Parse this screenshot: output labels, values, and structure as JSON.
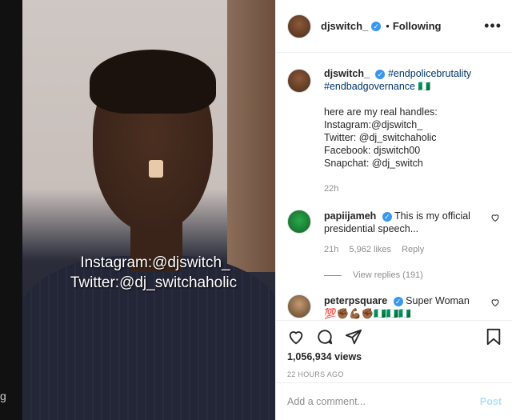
{
  "left_gutter": {
    "glyph": "g"
  },
  "video": {
    "overlay_line1": "Instagram:@djswitch_",
    "overlay_line2": "Twitter:@dj_switchaholic"
  },
  "header": {
    "username": "djswitch_",
    "separator": "•",
    "follow_status": "Following",
    "more": "•••"
  },
  "caption": {
    "username": "djswitch_",
    "hashtag1": "#endpolicebrutality",
    "hashtag2": "#endbadgovernance",
    "flag": "🇳🇬",
    "lines": [
      "here are my real handles:",
      "Instagram:@djswitch_",
      "Twitter: @dj_switchaholic",
      "Facebook: djswitch00",
      "Snapchat: @dj_switch"
    ],
    "time": "22h"
  },
  "comments": [
    {
      "username": "papiijameh",
      "text_line1": "This is my official",
      "text_line2": "presidential speech...",
      "time": "21h",
      "likes": "5,962 likes",
      "reply": "Reply",
      "view_replies": "View replies (191)"
    },
    {
      "username": "peterpsquare",
      "text": "Super Woman",
      "emojis": "💯✊🏾💪🏾✊🏾🇳🇬🇳🇬🇳🇬"
    }
  ],
  "actions": {
    "views": "1,056,934 views",
    "time_ago": "22 HOURS AGO"
  },
  "add_comment": {
    "placeholder": "Add a comment...",
    "post_label": "Post"
  },
  "colors": {
    "verified": "#3897f0",
    "hashtag": "#00376b",
    "post_disabled": "#b2dffc"
  }
}
